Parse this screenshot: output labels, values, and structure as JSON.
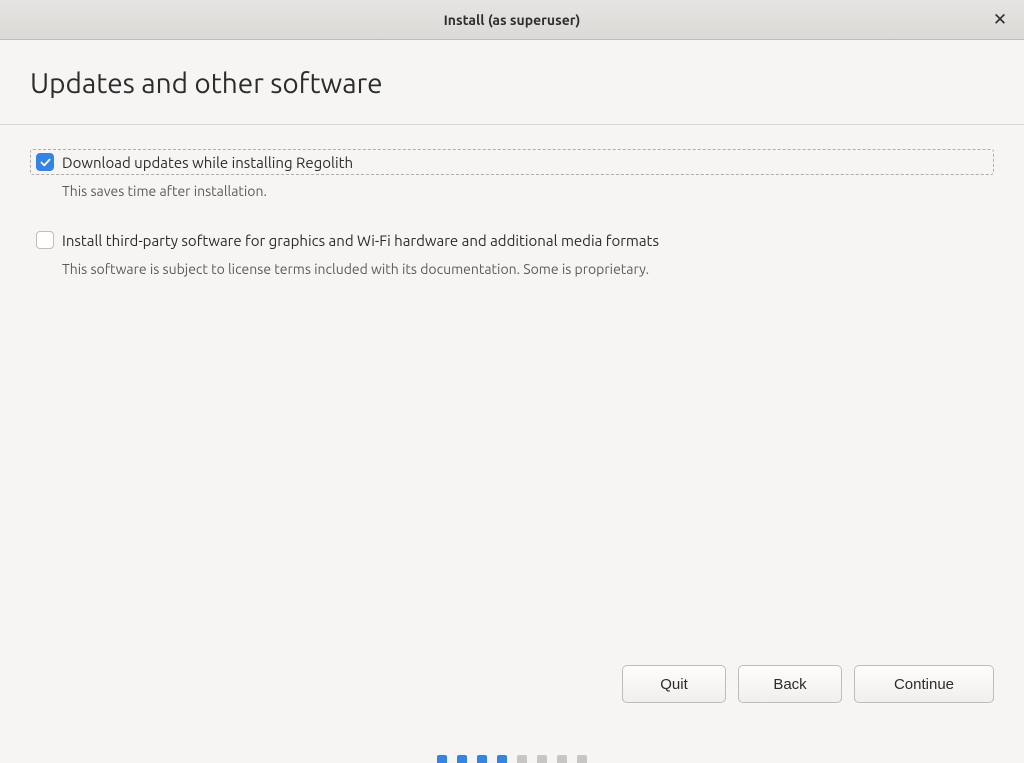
{
  "window": {
    "title": "Install (as superuser)"
  },
  "page": {
    "heading": "Updates and other software"
  },
  "options": {
    "download_updates": {
      "label": "Download updates while installing Regolith",
      "description": "This saves time after installation.",
      "checked": true
    },
    "third_party": {
      "label": "Install third-party software for graphics and Wi-Fi hardware and additional media formats",
      "description": "This software is subject to license terms included with its documentation. Some is proprietary.",
      "checked": false
    }
  },
  "buttons": {
    "quit": "Quit",
    "back": "Back",
    "continue": "Continue"
  },
  "progress": {
    "total": 8,
    "current": 4
  }
}
